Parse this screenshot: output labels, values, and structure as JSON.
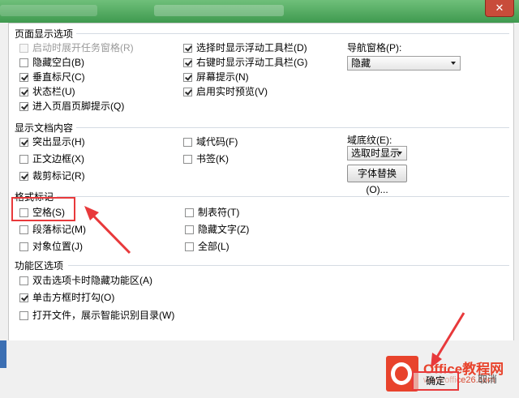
{
  "window": {
    "close_glyph": "✕"
  },
  "sections": {
    "page_display": "页面显示选项",
    "show_doc": "显示文档内容",
    "format_marks": "格式标记",
    "ribbon": "功能区选项"
  },
  "page_display": {
    "col1": [
      {
        "label": "启动时展开任务窗格(R)",
        "checked": false,
        "disabled": true
      },
      {
        "label": "隐藏空白(B)",
        "checked": false,
        "disabled": false
      },
      {
        "label": "垂直标尺(C)",
        "checked": true,
        "disabled": false
      },
      {
        "label": "状态栏(U)",
        "checked": true,
        "disabled": false
      },
      {
        "label": "进入页眉页脚提示(Q)",
        "checked": true,
        "disabled": false
      }
    ],
    "col2": [
      {
        "label": "选择时显示浮动工具栏(D)",
        "checked": true
      },
      {
        "label": "右键时显示浮动工具栏(G)",
        "checked": true
      },
      {
        "label": "屏幕提示(N)",
        "checked": true
      },
      {
        "label": "启用实时预览(V)",
        "checked": true
      }
    ],
    "nav_label": "导航窗格(P):",
    "nav_value": "隐藏"
  },
  "show_doc": {
    "col1": [
      {
        "label": "突出显示(H)",
        "checked": true
      },
      {
        "label": "正文边框(X)",
        "checked": false
      },
      {
        "label": "裁剪标记(R)",
        "checked": true
      }
    ],
    "col2": [
      {
        "label": "域代码(F)",
        "checked": false
      },
      {
        "label": "书签(K)",
        "checked": false
      }
    ],
    "shading_label": "域底纹(E):",
    "shading_value": "选取时显示",
    "font_sub_button": "字体替换(O)..."
  },
  "format_marks": {
    "col1": [
      {
        "label": "空格(S)",
        "checked": false
      },
      {
        "label": "段落标记(M)",
        "checked": false
      },
      {
        "label": "对象位置(J)",
        "checked": false
      }
    ],
    "col2": [
      {
        "label": "制表符(T)",
        "checked": false
      },
      {
        "label": "隐藏文字(Z)",
        "checked": false
      },
      {
        "label": "全部(L)",
        "checked": false
      }
    ]
  },
  "ribbon": {
    "items": [
      {
        "label": "双击选项卡时隐藏功能区(A)",
        "checked": false
      },
      {
        "label": "单击方框时打勾(O)",
        "checked": true
      },
      {
        "label": "打开文件，展示智能识别目录(W)",
        "checked": false
      }
    ]
  },
  "footer": {
    "ok_label": "确定",
    "cancel_label": "取消"
  },
  "watermark": {
    "brand": "Office教程网",
    "url": "www.office26.com",
    "color": "#e8432c"
  },
  "annotations": {
    "arrow_color": "#e8393b"
  }
}
